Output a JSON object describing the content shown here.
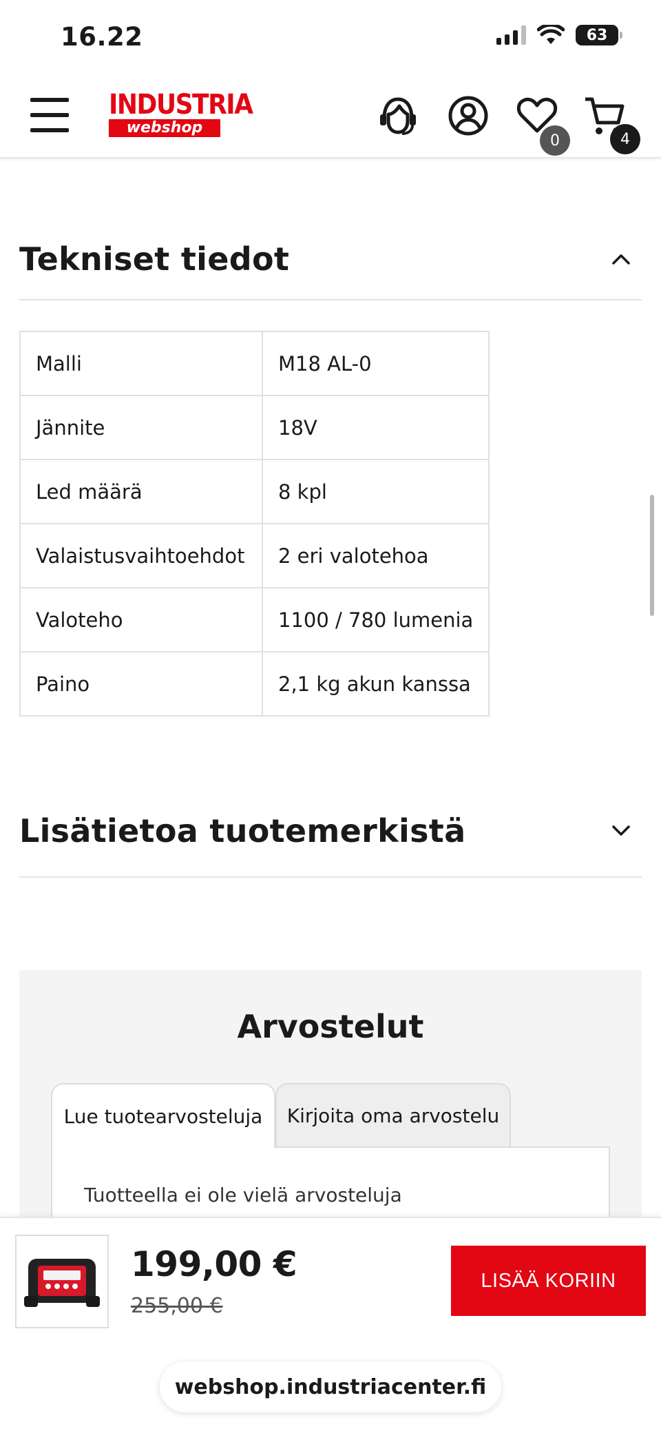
{
  "status_bar": {
    "time": "16.22",
    "battery": "63"
  },
  "header": {
    "logo_top": "INDUSTRIA",
    "logo_bottom": "webshop",
    "wishlist_count": "0",
    "cart_count": "4"
  },
  "tech_section": {
    "title": "Tekniset tiedot",
    "expanded": true,
    "rows": [
      {
        "key": "Malli",
        "value": "M18 AL-0"
      },
      {
        "key": "Jännite",
        "value": "18V"
      },
      {
        "key": "Led määrä",
        "value": "8 kpl"
      },
      {
        "key": "Valaistusvaihtoehdot",
        "value": "2 eri valotehoa"
      },
      {
        "key": "Valoteho",
        "value": "1100 / 780 lumenia"
      },
      {
        "key": "Paino",
        "value": "2,1 kg akun kanssa"
      }
    ]
  },
  "brand_section": {
    "title": "Lisätietoa tuotemerkistä",
    "expanded": false
  },
  "reviews": {
    "title": "Arvostelut",
    "tabs": [
      "Lue tuotearvosteluja",
      "Kirjoita oma arvostelu"
    ],
    "empty_text": "Tuotteella ei ole vielä arvosteluja"
  },
  "buy_bar": {
    "price": "199,00 €",
    "old_price": "255,00 €",
    "add_to_cart": "LISÄÄ KORIIN"
  },
  "browser": {
    "url": "webshop.industriacenter.fi"
  },
  "colors": {
    "brand_red": "#e30613",
    "text": "#1a1a1a",
    "panel_bg": "#f4f4f4"
  }
}
